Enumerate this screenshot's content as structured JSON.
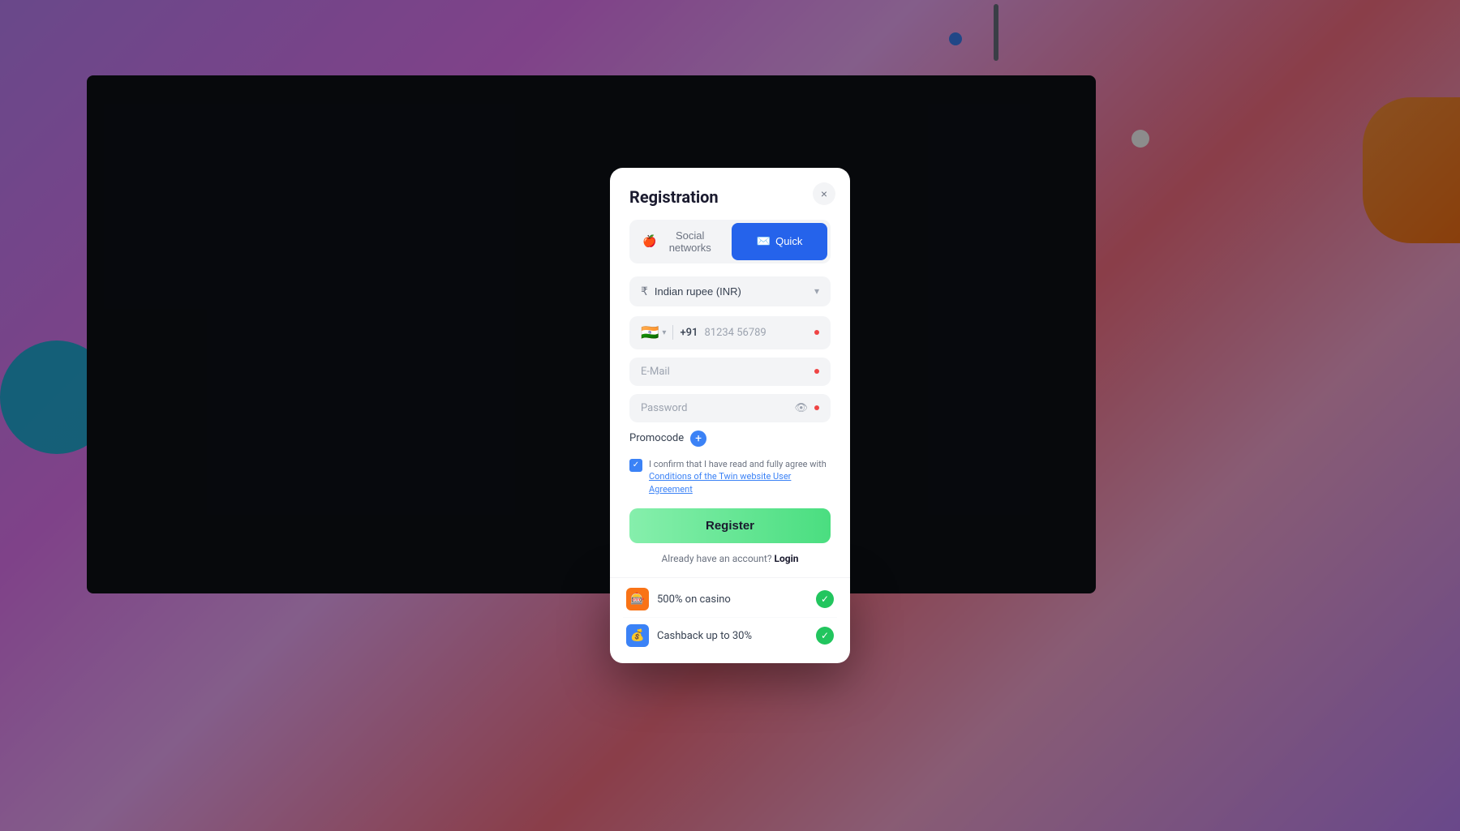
{
  "background": {
    "color": "#c084fc"
  },
  "modal": {
    "title": "Registration",
    "close_label": "×",
    "tabs": [
      {
        "id": "social",
        "label": "Social networks",
        "active": false,
        "icon": "🍎"
      },
      {
        "id": "quick",
        "label": "Quick",
        "active": true,
        "icon": "✉"
      }
    ],
    "currency_selector": {
      "icon": "₹",
      "label": "Indian rupee (INR)",
      "placeholder": "Indian rupee (INR)"
    },
    "phone_field": {
      "flag": "🇮🇳",
      "code": "+91",
      "placeholder": "81234 56789",
      "required": true
    },
    "email_field": {
      "placeholder": "E-Mail",
      "required": true
    },
    "password_field": {
      "placeholder": "Password",
      "required": true
    },
    "promocode": {
      "label": "Promocode",
      "plus_icon": "+"
    },
    "checkbox": {
      "checked": true,
      "text_before": "I confirm that I have read and fully agree with ",
      "link_text": "Conditions of the Twin website User Agreement",
      "text_after": ""
    },
    "register_button": "Register",
    "login_prompt": "Already have an account?",
    "login_link": "Login"
  },
  "bonuses": [
    {
      "id": "casino",
      "icon": "🎰",
      "text": "500% on casino",
      "checked": true
    },
    {
      "id": "cashback",
      "icon": "💰",
      "text": "Cashback up to 30%",
      "checked": true
    }
  ]
}
